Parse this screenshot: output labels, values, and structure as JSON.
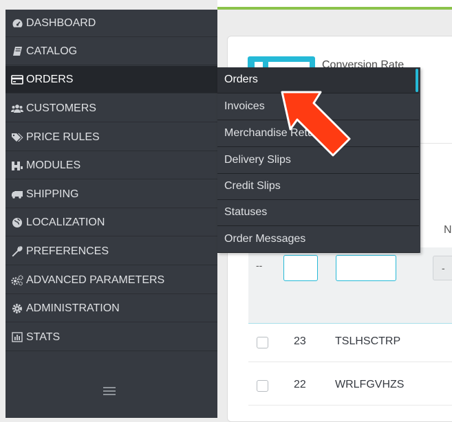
{
  "sidebar": {
    "items": [
      {
        "label": "DASHBOARD",
        "icon": "dashboard-icon"
      },
      {
        "label": "CATALOG",
        "icon": "book-icon"
      },
      {
        "label": "ORDERS",
        "icon": "credit-card-icon",
        "active": true
      },
      {
        "label": "CUSTOMERS",
        "icon": "users-icon"
      },
      {
        "label": "PRICE RULES",
        "icon": "tag-icon"
      },
      {
        "label": "MODULES",
        "icon": "puzzle-icon"
      },
      {
        "label": "SHIPPING",
        "icon": "truck-icon"
      },
      {
        "label": "LOCALIZATION",
        "icon": "globe-icon"
      },
      {
        "label": "PREFERENCES",
        "icon": "wrench-icon"
      },
      {
        "label": "ADVANCED PARAMETERS",
        "icon": "cogs-icon"
      },
      {
        "label": "ADMINISTRATION",
        "icon": "gear-icon"
      },
      {
        "label": "STATS",
        "icon": "bar-chart-icon"
      }
    ],
    "collapse_icon": "hamburger-icon"
  },
  "orders_menu": {
    "items": [
      "Orders",
      "Invoices",
      "Merchandise Returns",
      "Delivery Slips",
      "Credit Slips",
      "Statuses",
      "Order Messages"
    ],
    "active": "Orders"
  },
  "kpi": {
    "label": "Conversion Rate"
  },
  "table": {
    "col_n": "N",
    "filter_dashdash": "--",
    "filter_select": "-",
    "rows": [
      {
        "id": "23",
        "reference": "TSLHSCTRP"
      },
      {
        "id": "22",
        "reference": "WRLFGVHZS"
      }
    ]
  },
  "colors": {
    "accent": "#25b9d7",
    "topbar": "#8bc34a",
    "sidebar": "#363a41",
    "arrow": "#ff3b12"
  }
}
